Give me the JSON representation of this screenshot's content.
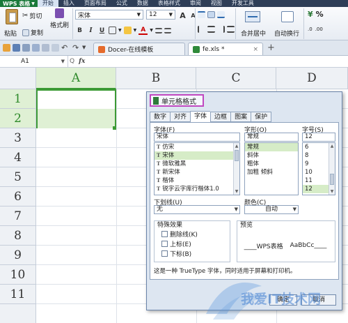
{
  "menubar": {
    "app_name": "WPS 表格",
    "items": [
      "开始",
      "插入",
      "页面布局",
      "公式",
      "数据",
      "表格样式",
      "审阅",
      "视图",
      "开发工具"
    ]
  },
  "ribbon": {
    "paste": "粘贴",
    "cut": "剪切",
    "copy": "复制",
    "format_painter": "格式刷",
    "font_name": "宋体",
    "font_size": "12",
    "merge_center": "合并居中",
    "wrap_text": "自动换行",
    "percent": "%",
    "bold": "B",
    "italic": "I",
    "underline": "U",
    "grow_font": "A",
    "shrink_font": "A"
  },
  "doctabs": {
    "tab1": "Docer-在线模板",
    "tab2": "fe.xls *",
    "close": "×",
    "add": "+"
  },
  "formula_bar": {
    "name_box": "A1",
    "fx": "fx",
    "zoom_icon": "Q"
  },
  "grid": {
    "columns": [
      "A",
      "B",
      "C",
      "D"
    ],
    "rows": [
      "1",
      "2",
      "3",
      "4",
      "5",
      "6",
      "7",
      "8",
      "9",
      "10",
      "11"
    ]
  },
  "dialog": {
    "title": "单元格格式",
    "tabs": [
      "数字",
      "对齐",
      "字体",
      "边框",
      "图案",
      "保护"
    ],
    "font_label": "字体(F)",
    "font_value": "宋体",
    "fonts": [
      "仿宋",
      "宋体",
      "微软雅黑",
      "新宋体",
      "楷体",
      "锐字云字库行楷体1.0"
    ],
    "style_label": "字形(O)",
    "style_value": "常规",
    "styles": [
      "常规",
      "斜体",
      "粗体",
      "加粗 倾斜"
    ],
    "size_label": "字号(S)",
    "size_value": "12",
    "sizes": [
      "6",
      "8",
      "9",
      "10",
      "11",
      "12"
    ],
    "underline_label": "下划线(U)",
    "underline_value": "无",
    "color_label": "颜色(C)",
    "color_value": "自动",
    "effects_label": "特殊效果",
    "effects": [
      "删除线(K)",
      "上标(E)",
      "下标(B)"
    ],
    "preview_label": "预览",
    "preview_text1": "WPS表格",
    "preview_text2": "AaBbCc",
    "note": "这是一种 TrueType 字体，同时适用于屏幕和打印机。",
    "ok": "确定",
    "cancel": "取消"
  },
  "watermark": {
    "text": "我爱IT技术网"
  }
}
